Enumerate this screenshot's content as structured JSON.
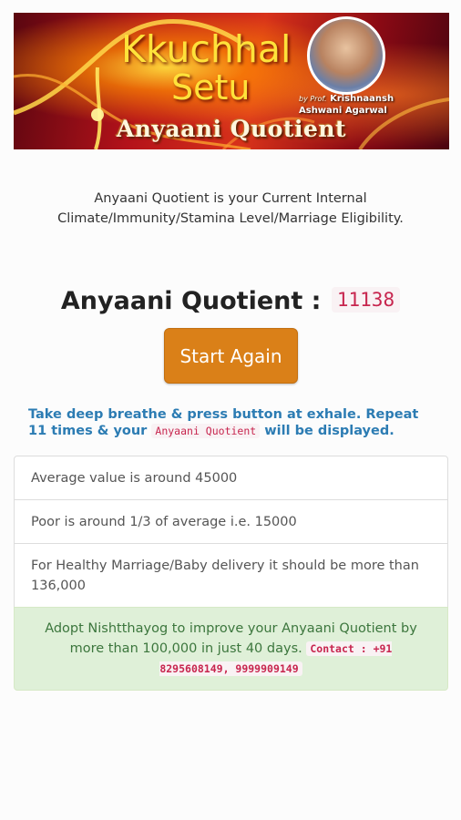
{
  "banner": {
    "brand_line1": "Kkuchhal",
    "brand_line2": "Setu",
    "byline_prefix": "by Prof.",
    "author_first": "Krishnaansh",
    "author_second": "Ashwani Agarwal",
    "subtitle": "Anyaani Quotient"
  },
  "intro": {
    "text": "Anyaani Quotient is your Current Internal Climate/Immunity/Stamina Level/Marriage Eligibility."
  },
  "result": {
    "label": "Anyaani Quotient :",
    "value": "11138"
  },
  "start_button": {
    "label": "Start Again"
  },
  "instruction": {
    "before": "Take deep breathe & press button at exhale. Repeat 11 times & your",
    "code": "Anyaani Quotient",
    "after": "will be displayed."
  },
  "info_list": {
    "items": [
      "Average value is around 45000",
      "Poor is around 1/3 of average i.e. 15000",
      "For Healthy Marriage/Baby delivery it should be more than 136,000"
    ],
    "success_text": "Adopt Nishtthayog to improve your Anyaani Quotient by more than 100,000 in just 40 days.",
    "contact": "Contact : +91 8295608149, 9999909149"
  },
  "colors": {
    "button": "#da8018",
    "instruction": "#2c7cb3",
    "code_text": "#c7254e",
    "code_bg": "#f9f2f4",
    "success_bg": "#dff0d8",
    "success_text": "#3c763d",
    "brand_yellow": "#ffe23a"
  }
}
